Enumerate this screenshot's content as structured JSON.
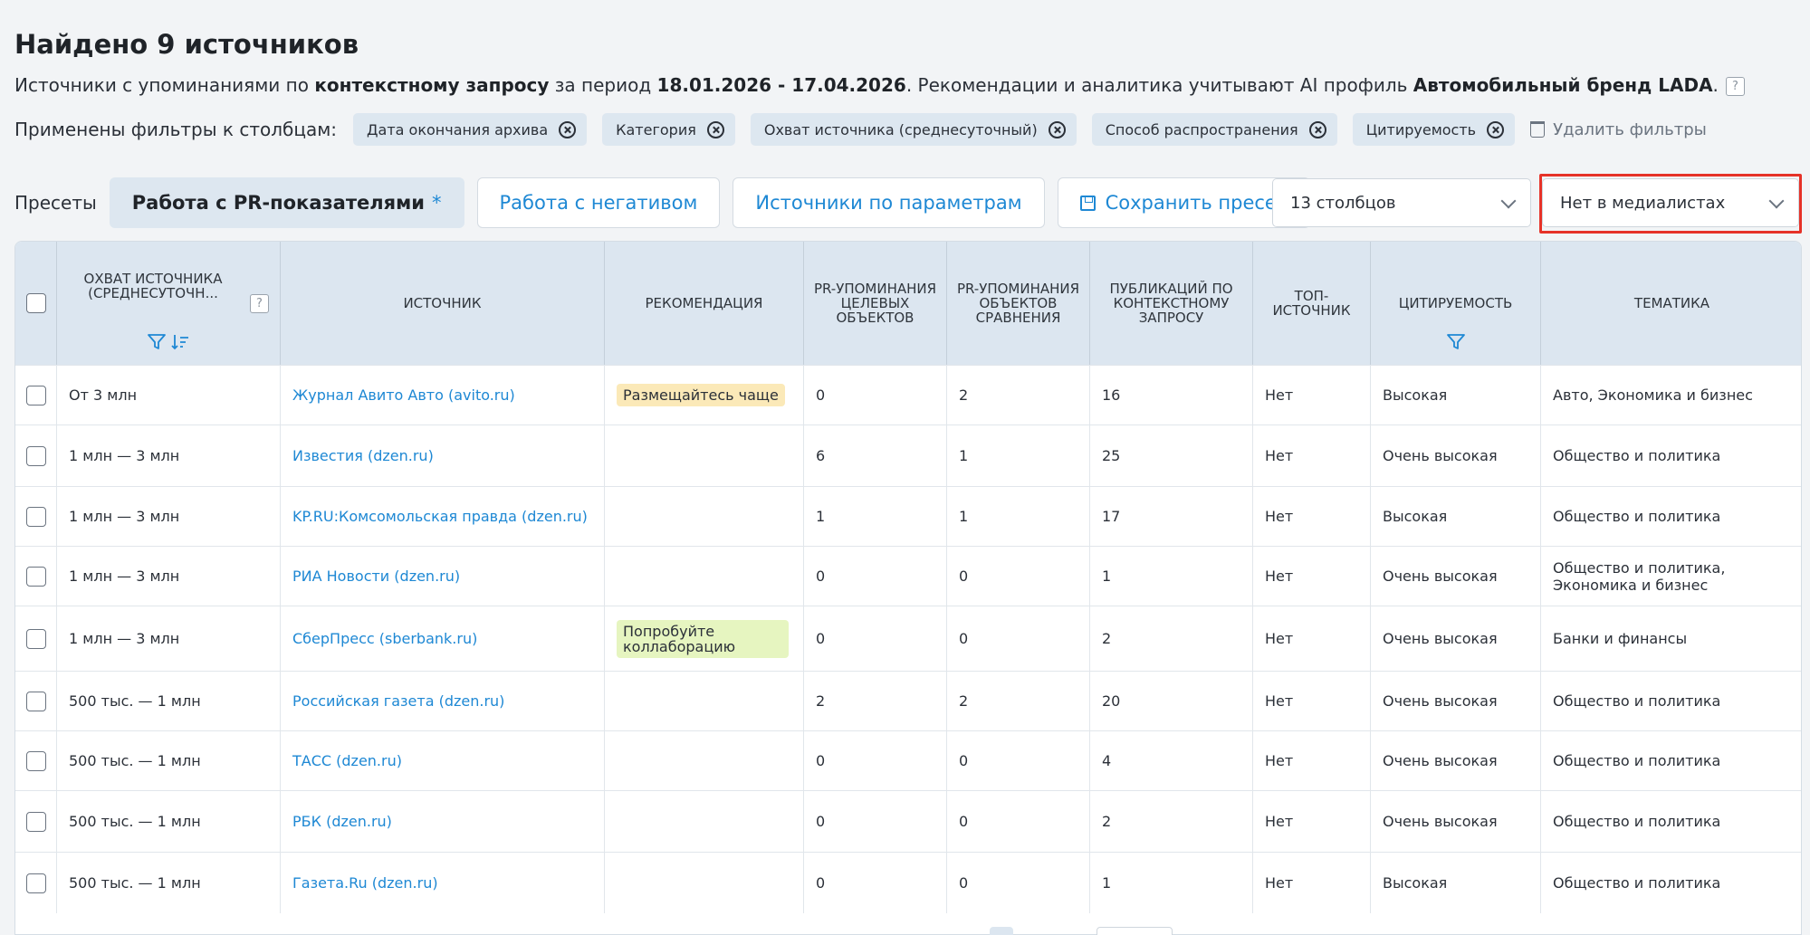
{
  "header": {
    "title": "Найдено 9 источников",
    "subtitle": {
      "part1": "Источники с упоминаниями по ",
      "bold1": "контекстному запросу",
      "part2": " за период ",
      "bold2": "18.01.2026 - 17.04.2026",
      "part3": ". Рекомендации и аналитика учитывают AI профиль ",
      "bold3": "Автомобильный бренд LADA",
      "part4": "."
    },
    "help_glyph": "?"
  },
  "filters": {
    "label": "Применены фильтры к столбцам:",
    "chips": [
      "Дата окончания архива",
      "Категория",
      "Охват источника (среднесуточный)",
      "Способ распространения",
      "Цитируемость"
    ],
    "delete_label": "Удалить фильтры"
  },
  "presets": {
    "label": "Пресеты",
    "active_label": "Работа с PR-показателями",
    "active_star": "*",
    "items": [
      "Работа с негативом",
      "Источники по параметрам"
    ],
    "save_label": "Сохранить пресет"
  },
  "columns_select": {
    "value": "13 столбцов"
  },
  "media_select": {
    "value": "Нет в медиалистах"
  },
  "table": {
    "columns": [
      "ОХВАТ ИСТОЧНИКА (СРЕДНЕСУТОЧН...",
      "ИСТОЧНИК",
      "РЕКОМЕНДАЦИЯ",
      "PR-УПОМИНАНИЯ ЦЕЛЕВЫХ ОБЪЕКТОВ",
      "PR-УПОМИНАНИЯ ОБЪЕКТОВ СРАВНЕНИЯ",
      "ПУБЛИКАЦИЙ ПО КОНТЕКСТНОМУ ЗАПРОСУ",
      "ТОП-ИСТОЧНИК",
      "ЦИТИРУЕМОСТЬ",
      "ТЕМАТИКА"
    ],
    "rows": [
      {
        "reach": "От 3 млн",
        "source": "Журнал Авито Авто (avito.ru)",
        "rec": "Размещайтесь чаще",
        "pr_target": "0",
        "pr_compare": "2",
        "pubs": "16",
        "top": "Нет",
        "cite": "Высокая",
        "topic": "Авто, Экономика и бизнес"
      },
      {
        "reach": "1 млн — 3 млн",
        "source": "Известия (dzen.ru)",
        "rec": "",
        "pr_target": "6",
        "pr_compare": "1",
        "pubs": "25",
        "top": "Нет",
        "cite": "Очень высокая",
        "topic": "Общество и политика"
      },
      {
        "reach": "1 млн — 3 млн",
        "source": "KP.RU:Комсомольская правда (dzen.ru)",
        "rec": "",
        "pr_target": "1",
        "pr_compare": "1",
        "pubs": "17",
        "top": "Нет",
        "cite": "Высокая",
        "topic": "Общество и политика"
      },
      {
        "reach": "1 млн — 3 млн",
        "source": "РИА Новости (dzen.ru)",
        "rec": "",
        "pr_target": "0",
        "pr_compare": "0",
        "pubs": "1",
        "top": "Нет",
        "cite": "Очень высокая",
        "topic": "Общество и политика, Экономика и бизнес"
      },
      {
        "reach": "1 млн — 3 млн",
        "source": "СберПресс (sberbank.ru)",
        "rec": "Попробуйте коллаборацию",
        "pr_target": "0",
        "pr_compare": "0",
        "pubs": "2",
        "top": "Нет",
        "cite": "Очень высокая",
        "topic": "Банки и финансы"
      },
      {
        "reach": "500 тыс. — 1 млн",
        "source": "Российская газета (dzen.ru)",
        "rec": "",
        "pr_target": "2",
        "pr_compare": "2",
        "pubs": "20",
        "top": "Нет",
        "cite": "Очень высокая",
        "topic": "Общество и политика"
      },
      {
        "reach": "500 тыс. — 1 млн",
        "source": "ТАСС (dzen.ru)",
        "rec": "",
        "pr_target": "0",
        "pr_compare": "0",
        "pubs": "4",
        "top": "Нет",
        "cite": "Очень высокая",
        "topic": "Общество и политика"
      },
      {
        "reach": "500 тыс. — 1 млн",
        "source": "РБК (dzen.ru)",
        "rec": "",
        "pr_target": "0",
        "pr_compare": "0",
        "pubs": "2",
        "top": "Нет",
        "cite": "Очень высокая",
        "topic": "Общество и политика"
      },
      {
        "reach": "500 тыс. — 1 млн",
        "source": "Газета.Ru (dzen.ru)",
        "rec": "",
        "pr_target": "0",
        "pr_compare": "0",
        "pubs": "1",
        "top": "Нет",
        "cite": "Высокая",
        "topic": "Общество и политика"
      }
    ]
  },
  "colors": {
    "accent": "#1e88d4",
    "header_bg": "#dce6f0",
    "chip_bg": "#dde7f0",
    "highlight": "#e63228",
    "badge_orange": "#fbe9b8",
    "badge_green": "#e6f5c0"
  }
}
